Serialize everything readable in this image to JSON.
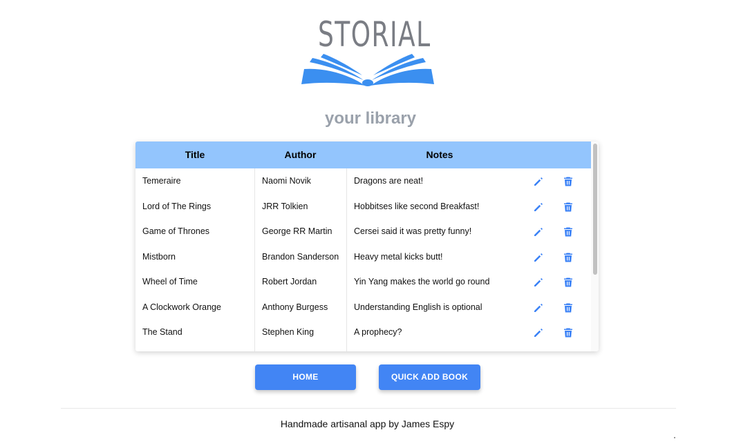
{
  "brand": {
    "logo_text": "STORIAL",
    "accent_color": "#4285f4",
    "header_color": "#93c5fd"
  },
  "page": {
    "subtitle": "your library"
  },
  "table": {
    "headers": {
      "title": "Title",
      "author": "Author",
      "notes": "Notes"
    },
    "rows": [
      {
        "title": "Temeraire",
        "author": "Naomi Novik",
        "notes": "Dragons are neat!"
      },
      {
        "title": "Lord of The Rings",
        "author": "JRR Tolkien",
        "notes": "Hobbitses like second Breakfast!"
      },
      {
        "title": "Game of Thrones",
        "author": "George RR Martin",
        "notes": "Cersei said it was pretty funny!"
      },
      {
        "title": "Mistborn",
        "author": "Brandon Sanderson",
        "notes": "Heavy metal kicks butt!"
      },
      {
        "title": "Wheel of Time",
        "author": "Robert Jordan",
        "notes": "Yin Yang makes the world go round"
      },
      {
        "title": "A Clockwork Orange",
        "author": "Anthony Burgess",
        "notes": "Understanding English is optional"
      },
      {
        "title": "The Stand",
        "author": "Stephen King",
        "notes": "A prophecy?"
      }
    ],
    "row_icons": {
      "edit": "pencil-icon",
      "delete": "trash-icon"
    }
  },
  "actions": {
    "home_label": "HOME",
    "quick_add_label": "QUICK ADD BOOK"
  },
  "footer": {
    "text": "Handmade artisanal app by James Espy"
  }
}
